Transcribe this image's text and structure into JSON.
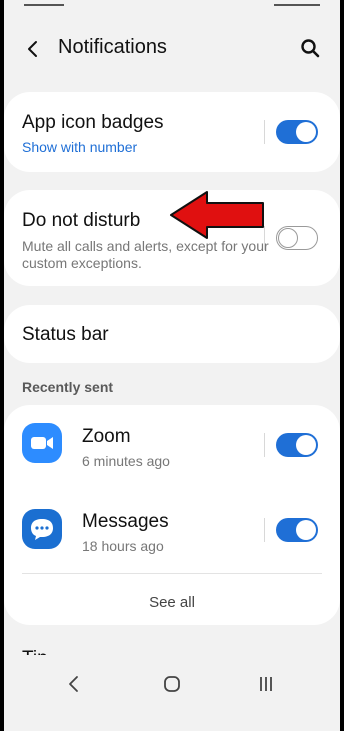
{
  "header": {
    "title": "Notifications"
  },
  "settings": {
    "app_icon_badges": {
      "title": "App icon badges",
      "subtitle": "Show with number",
      "toggle_on": true
    },
    "do_not_disturb": {
      "title": "Do not disturb",
      "description": "Mute all calls and alerts, except for your custom exceptions.",
      "toggle_on": false
    },
    "status_bar": {
      "title": "Status bar"
    }
  },
  "recently_sent": {
    "header": "Recently sent",
    "apps": [
      {
        "name": "Zoom",
        "time": "6 minutes ago",
        "toggle_on": true,
        "icon": "zoom-camera-icon"
      },
      {
        "name": "Messages",
        "time": "18 hours ago",
        "toggle_on": true,
        "icon": "messages-bubble-icon"
      }
    ],
    "see_all": "See all"
  },
  "tip": {
    "title": "Tip"
  },
  "colors": {
    "accent": "#1f6fd6",
    "annotation_arrow": "#e01010",
    "background": "#f2f2f2"
  }
}
